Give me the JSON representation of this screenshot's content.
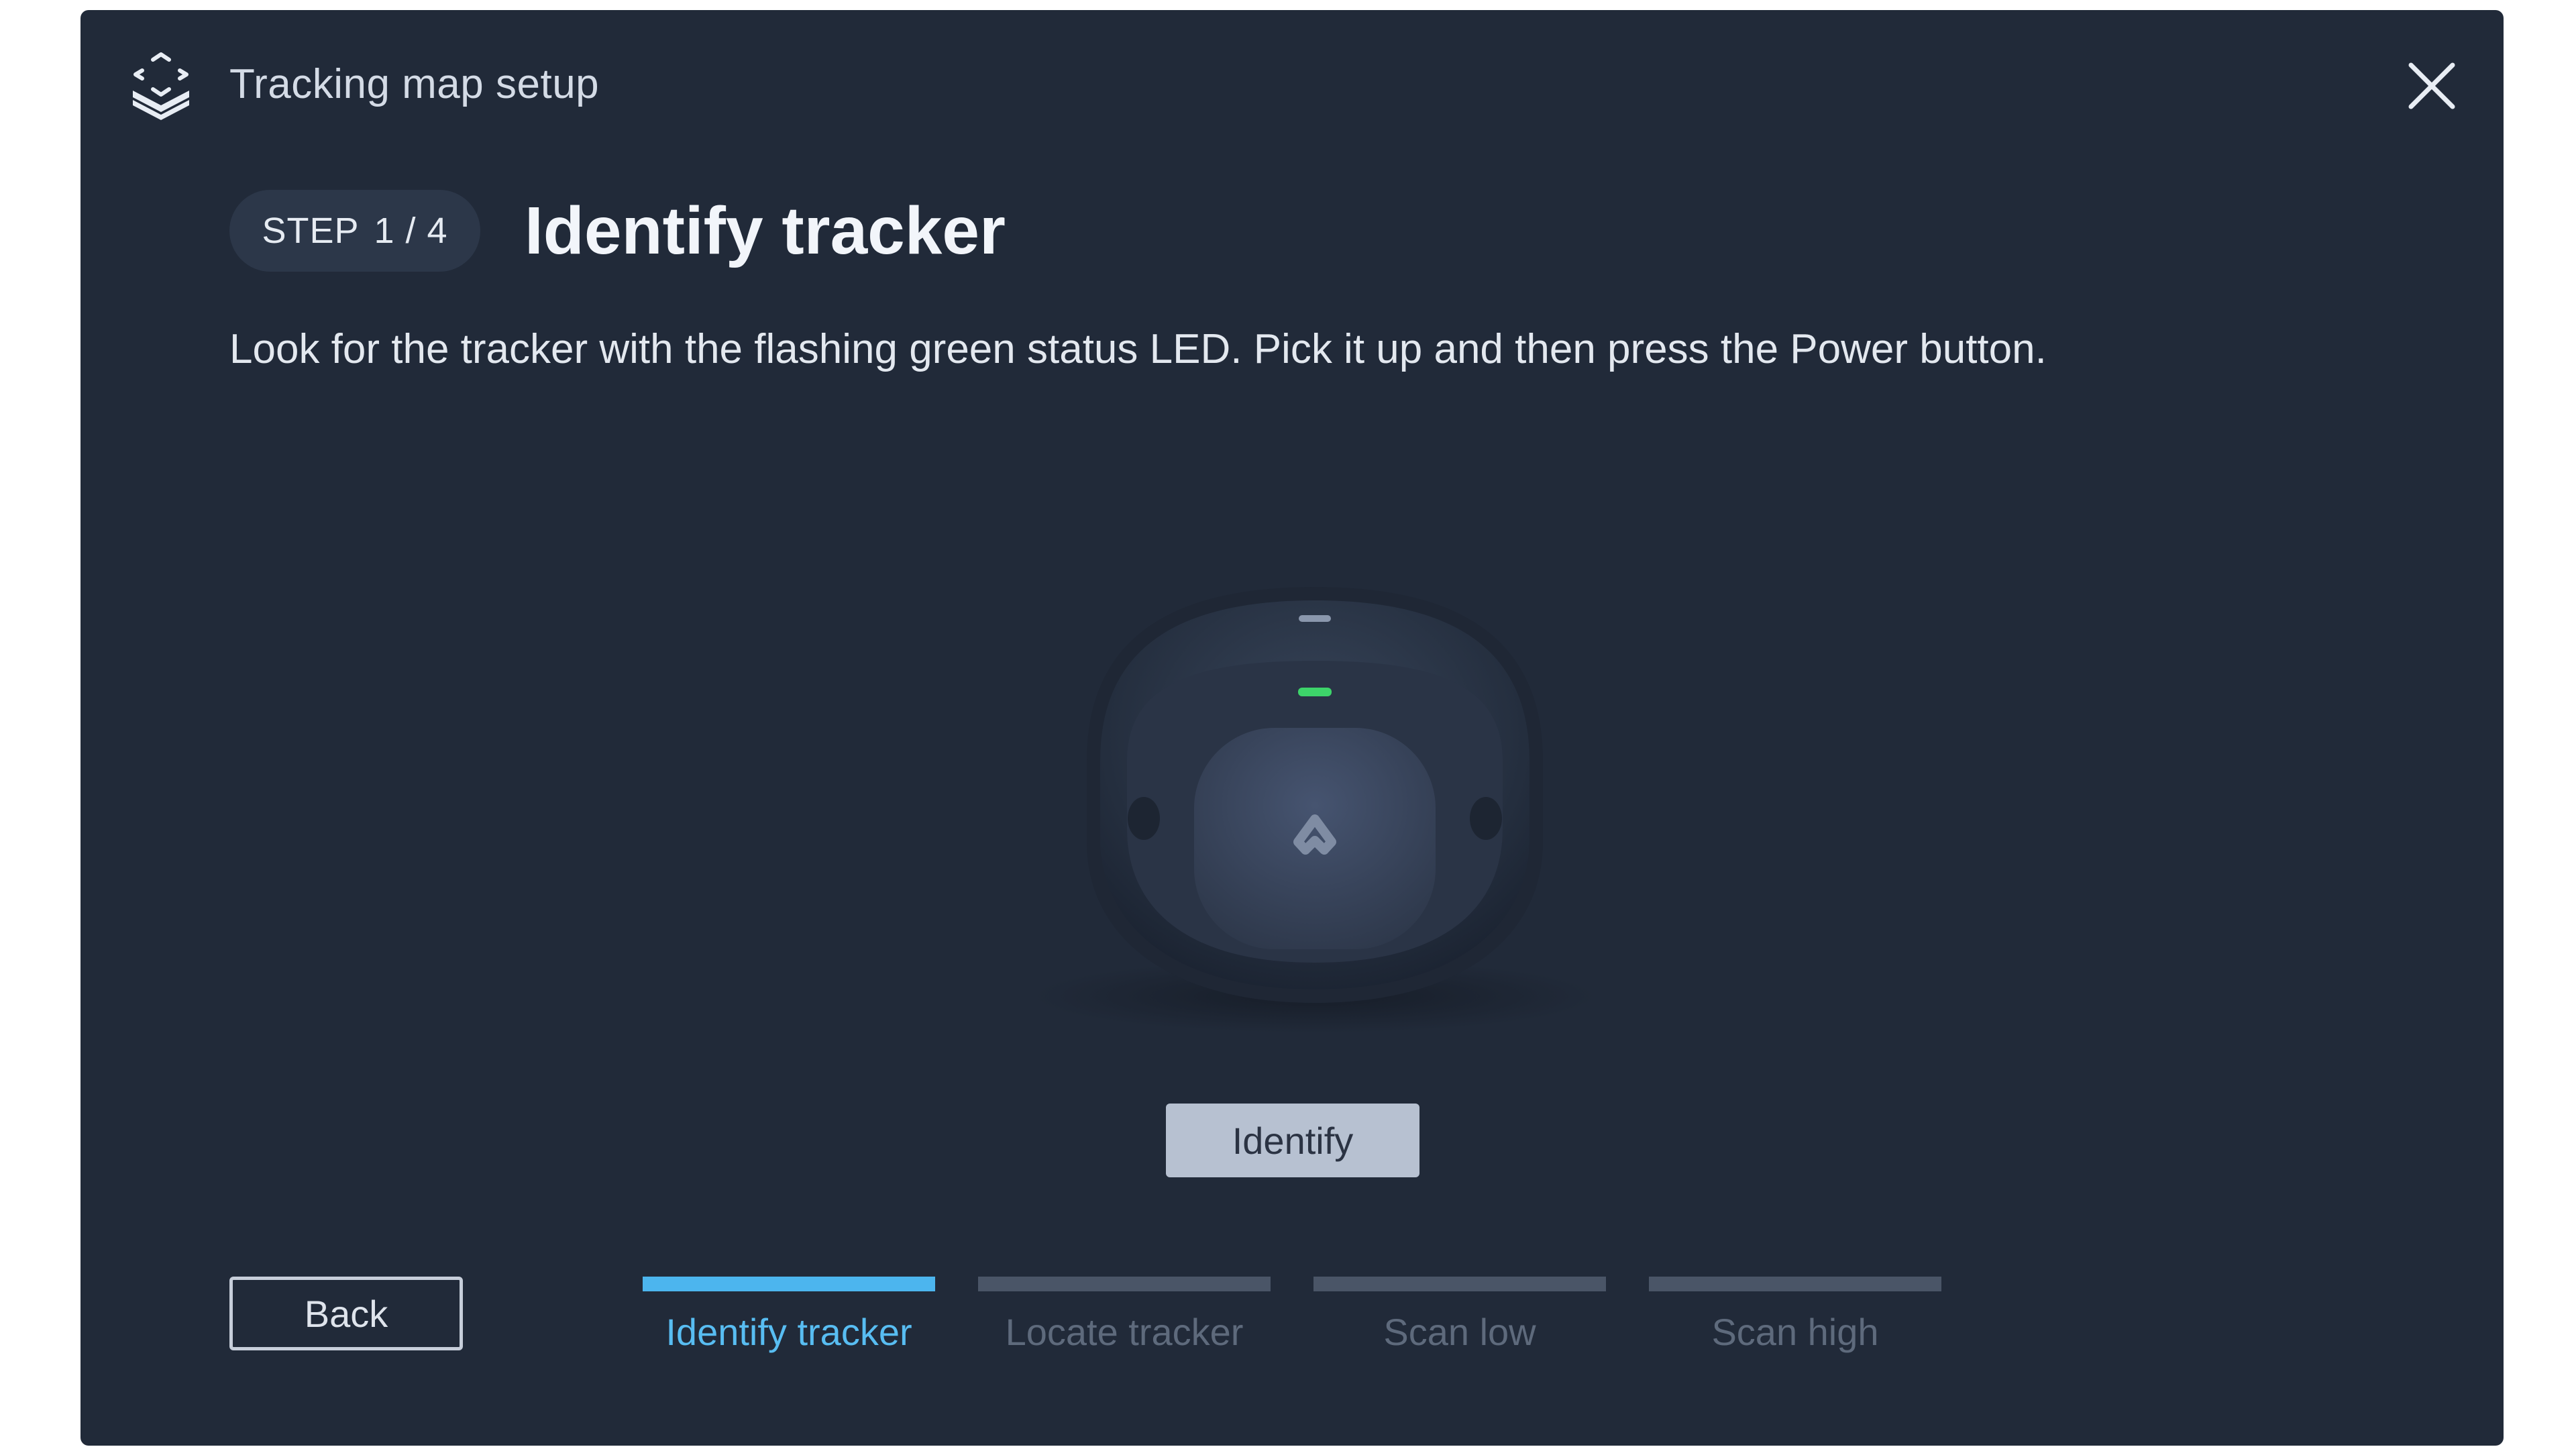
{
  "window": {
    "title": "Tracking map setup",
    "icon": "layers-scan-icon",
    "close_icon": "close-icon"
  },
  "step": {
    "label": "STEP",
    "counter": "1 / 4",
    "title": "Identify tracker",
    "instructions": "Look for the tracker with the flashing green status LED. Pick it up and then press the Power button."
  },
  "illustration": {
    "name": "tracker-device-image",
    "led_color": "#3dd46a"
  },
  "buttons": {
    "identify": "Identify",
    "back": "Back"
  },
  "progress": {
    "steps": [
      {
        "label": "Identify tracker",
        "active": true
      },
      {
        "label": "Locate tracker",
        "active": false
      },
      {
        "label": "Scan low",
        "active": false
      },
      {
        "label": "Scan high",
        "active": false
      }
    ]
  },
  "colors": {
    "background": "#212a39",
    "accent": "#4cb5ee",
    "inactive": "#4a5567"
  }
}
